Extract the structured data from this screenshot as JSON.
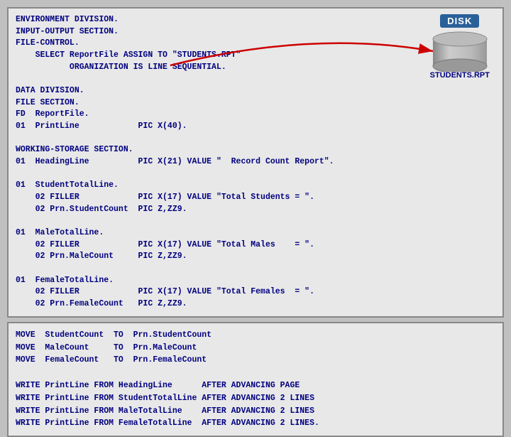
{
  "top_panel": {
    "lines": [
      "ENVIRONMENT DIVISION.",
      "INPUT-OUTPUT SECTION.",
      "FILE-CONTROL.",
      "    SELECT ReportFile ASSIGN TO \"STUDENTS.RPT\"",
      "           ORGANIZATION IS LINE SEQUENTIAL.",
      "",
      "DATA DIVISION.",
      "FILE SECTION.",
      "FD  ReportFile.",
      "01  PrintLine            PIC X(40).",
      "",
      "WORKING-STORAGE SECTION.",
      "01  HeadingLine          PIC X(21) VALUE \"  Record Count Report\".",
      "",
      "01  StudentTotalLine.",
      "    02 FILLER            PIC X(17) VALUE \"Total Students = \".",
      "    02 Prn.StudentCount  PIC Z,ZZ9.",
      "",
      "01  MaleTotalLine.",
      "    02 FILLER            PIC X(17) VALUE \"Total Males    = \".",
      "    02 Prn.MaleCount     PIC Z,ZZ9.",
      "",
      "01  FemaleTotalLine.",
      "    02 FILLER            PIC X(17) VALUE \"Total Females  = \".",
      "    02 Prn.FemaleCount   PIC Z,ZZ9."
    ]
  },
  "disk": {
    "label": "DISK",
    "filename": "STUDENTS.RPT"
  },
  "bottom_panel": {
    "lines": [
      "MOVE  StudentCount  TO  Prn.StudentCount",
      "MOVE  MaleCount     TO  Prn.MaleCount",
      "MOVE  FemaleCount   TO  Prn.FemaleCount",
      "",
      "WRITE PrintLine FROM HeadingLine      AFTER ADVANCING PAGE",
      "WRITE PrintLine FROM StudentTotalLine AFTER ADVANCING 2 LINES",
      "WRITE PrintLine FROM MaleTotalLine    AFTER ADVANCING 2 LINES",
      "WRITE PrintLine FROM FemaleTotalLine  AFTER ADVANCING 2 LINES."
    ]
  }
}
